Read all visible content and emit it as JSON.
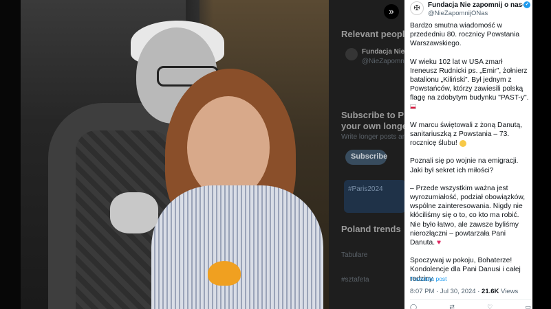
{
  "sidebar": {
    "blocks": [
      {
        "text": "Relevant people"
      },
      {
        "text": "Fundacja Nie z"
      },
      {
        "text": "Subscribe to P"
      },
      {
        "text": "your own longe"
      },
      {
        "text": "Poland trends"
      }
    ],
    "subs": [
      {
        "text": "@NieZapomnijONas"
      },
      {
        "text": "Write longer posts and"
      },
      {
        "text": "Tabulare"
      },
      {
        "text": "#sztafeta"
      }
    ],
    "subscribe_label": "Subscribe",
    "card_label": "#Paris2024"
  },
  "tweet": {
    "account_name": "Fundacja Nie zapomnij o nas",
    "handle": "@NieZapomnijONas",
    "paragraphs": [
      "Bardzo smutna wiadomość w przededniu 80. rocznicy Powstania Warszawskiego.",
      "W wieku 102 lat w USA zmarł Ireneusz Rudnicki ps. „Emir”, żołnierz batalionu „Kiliński”. Był jednym z Powstańców, którzy zawiesili polską flagę na zdobytym budynku \"PAST-y\".",
      "W marcu świętowali z żoną Danutą, sanitariuszką z Powstania – 73. rocznicę ślubu!",
      "Poznali się po wojnie na emigracji. Jaki był sekret ich miłości?",
      "– Przede wszystkim ważna jest wyrozumiałość, podział obowiązków, wspólne zainteresowania. Nigdy nie kłóciliśmy się o to, co kto ma robić. Nie było łatwo, ale zawsze byliśmy nierozłączni – powtarzała Pani Danuta.",
      "Spoczywaj w pokoju, Bohaterze! Kondolencje dla Pani Danusi i całej rodziny."
    ],
    "translate_label": "Translate post",
    "time": "8:07 PM · Jul 30, 2024 · ",
    "views_count": "21.6K",
    "views_label": " Views"
  },
  "icons": {
    "expand": "expand-icon",
    "more": "more-icon",
    "verified": "verified-badge-icon",
    "flag": "poland-flag-emoji",
    "heart": "red-heart-emoji",
    "smile": "smiling-face-emoji"
  },
  "colors": {
    "accent": "#1d9bf0",
    "heart": "#e0245e"
  }
}
